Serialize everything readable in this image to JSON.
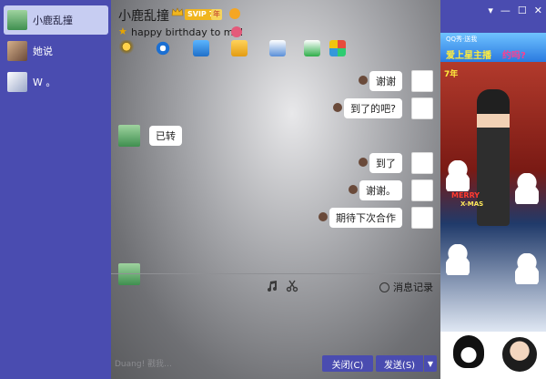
{
  "contacts": [
    {
      "name": "小鹿乱撞",
      "active": true
    },
    {
      "name": "她说",
      "active": false
    },
    {
      "name": "W  。",
      "active": false
    }
  ],
  "chat": {
    "title": "小鹿乱撞",
    "vip_label": "SVIP 7",
    "year_badge": "年",
    "status_text": "happy birthday to me!",
    "messages": [
      {
        "side": "right",
        "text": "谢谢"
      },
      {
        "side": "right",
        "text": "到了的吧?"
      },
      {
        "side": "left",
        "text": "已转"
      },
      {
        "side": "right",
        "text": "到了"
      },
      {
        "side": "right",
        "text": "谢谢。"
      },
      {
        "side": "right",
        "text": "期待下次合作"
      }
    ],
    "history_label": "消息记录",
    "input_hint": "Duang! 戳我…",
    "close_label": "关闭(C)",
    "send_label": "发送(S)"
  },
  "ad": {
    "tagline": "QQ秀·送我",
    "slogan": "爱上星主播",
    "slogan2": "约吗?",
    "year_badge": "7年",
    "merry_text": "MERRY",
    "xmas_text": "X-MAS"
  },
  "icons": {
    "crown": "crown-icon",
    "star": "star-icon",
    "clock": "clock-icon"
  }
}
